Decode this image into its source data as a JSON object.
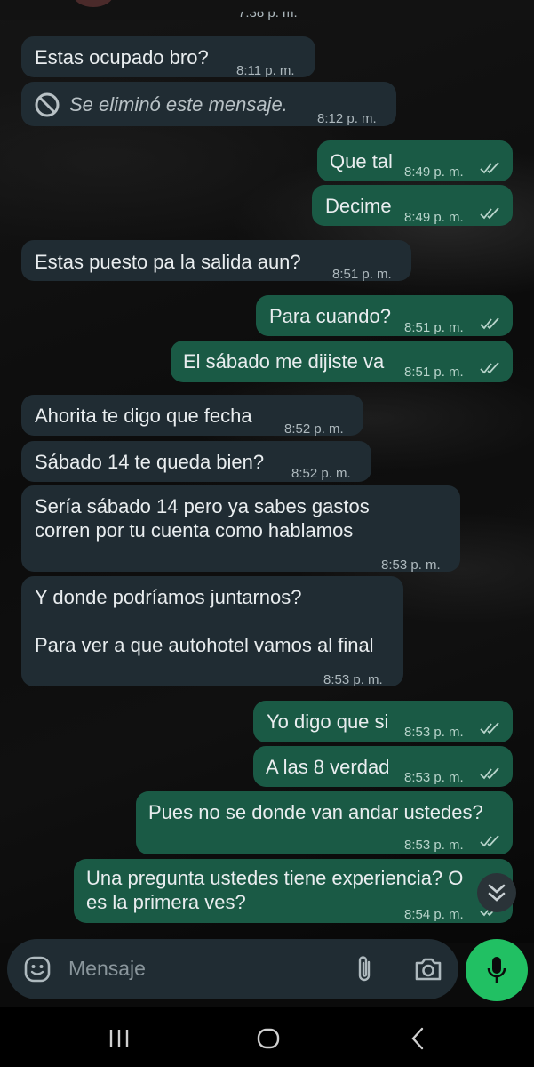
{
  "top": {
    "prev_time": "7:38 p. m."
  },
  "messages": [
    {
      "dir": "in",
      "text": "Estas ocupado bro?",
      "time": "8:11 p. m."
    },
    {
      "dir": "in",
      "text": "Se eliminó este mensaje.",
      "time": "8:12 p. m.",
      "deleted": true
    },
    {
      "dir": "out",
      "text": "Que tal",
      "time": "8:49 p. m."
    },
    {
      "dir": "out",
      "text": "Decime",
      "time": "8:49 p. m."
    },
    {
      "dir": "in",
      "text": "Estas puesto pa la salida aun?",
      "time": "8:51 p. m."
    },
    {
      "dir": "out",
      "text": "Para cuando?",
      "time": "8:51 p. m."
    },
    {
      "dir": "out",
      "text": "El sábado me dijiste va",
      "time": "8:51 p. m."
    },
    {
      "dir": "in",
      "text": "Ahorita te digo que fecha",
      "time": "8:52 p. m."
    },
    {
      "dir": "in",
      "text": "Sábado 14 te queda bien?",
      "time": "8:52 p. m."
    },
    {
      "dir": "in",
      "text": "Sería sábado 14 pero ya sabes gastos\ncorren por tu cuenta como hablamos",
      "time": "8:53 p. m."
    },
    {
      "dir": "in",
      "text": "Y donde podríamos juntarnos?\n\nPara ver a que autohotel vamos al final",
      "time": "8:53 p. m."
    },
    {
      "dir": "out",
      "text": "Yo digo que si",
      "time": "8:53 p. m."
    },
    {
      "dir": "out",
      "text": "A las 8 verdad",
      "time": "8:53 p. m."
    },
    {
      "dir": "out",
      "text": "Pues no se donde van andar ustedes?",
      "time": "8:53 p. m."
    },
    {
      "dir": "out",
      "text": "Una pregunta ustedes tiene experiencia? O\nes la primera ves?",
      "time": "8:54 p. m."
    }
  ],
  "composer": {
    "placeholder": "Mensaje",
    "icons": [
      "emoji-icon",
      "attach-icon",
      "camera-icon",
      "mic-icon"
    ]
  },
  "colors": {
    "incoming": "#202c33",
    "outgoing": "#1a5a45",
    "mic": "#21c063",
    "ticks": "#aeb9be"
  }
}
